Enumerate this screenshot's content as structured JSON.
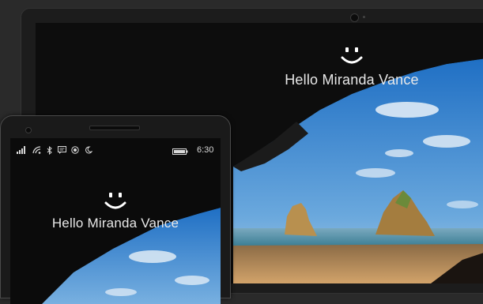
{
  "laptop": {
    "greeting": "Hello Miranda Vance",
    "face_icon": "smiley-face-icon"
  },
  "phone": {
    "greeting": "Hello Miranda Vance",
    "face_icon": "smiley-face-icon",
    "status_bar": {
      "icons": [
        "signal-bars-icon",
        "wifi-icon",
        "bluetooth-icon",
        "message-icon",
        "location-icon",
        "quiet-hours-moon-icon"
      ],
      "battery_icon": "battery-icon",
      "time": "6:30"
    }
  },
  "colors": {
    "sky": "#4a8fd0",
    "cave": "#121212",
    "sand": "#c79a5e",
    "sea": "#6a9fb8",
    "text": "#e8e8e8"
  }
}
